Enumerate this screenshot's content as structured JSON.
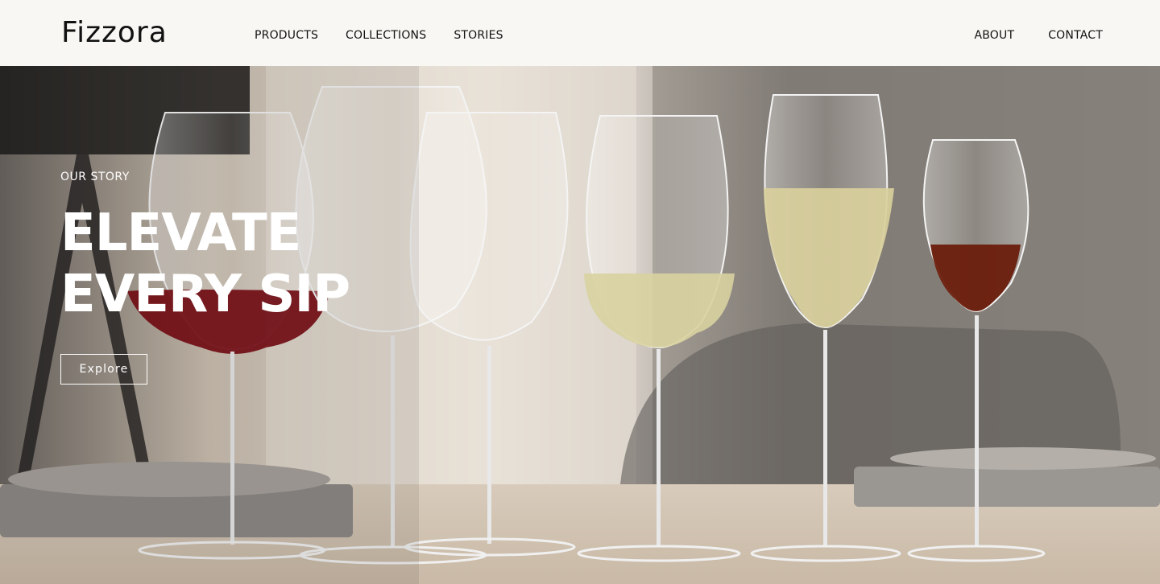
{
  "brand": {
    "name": "Fizzora"
  },
  "nav": {
    "left": [
      {
        "label": "PRODUCTS"
      },
      {
        "label": "COLLECTIONS"
      },
      {
        "label": "STORIES"
      }
    ],
    "right": [
      {
        "label": "ABOUT"
      },
      {
        "label": "CONTACT"
      }
    ]
  },
  "hero": {
    "eyebrow": "OUR STORY",
    "headline_line1": "ELEVATE",
    "headline_line2": "EVERY SIP",
    "cta_label": "Explore",
    "image_subject": "six wine glasses on a table (red wine, empty, empty, white wine, champagne, dessert wine)"
  },
  "colors": {
    "header_bg": "#f8f7f4",
    "text_dark": "#111111",
    "hero_text": "#ffffff",
    "red_wine": "#7a0e16",
    "white_wine": "#d8d2a0",
    "champagne": "#d9cf9c",
    "dessert_wine": "#6b1e0c"
  }
}
